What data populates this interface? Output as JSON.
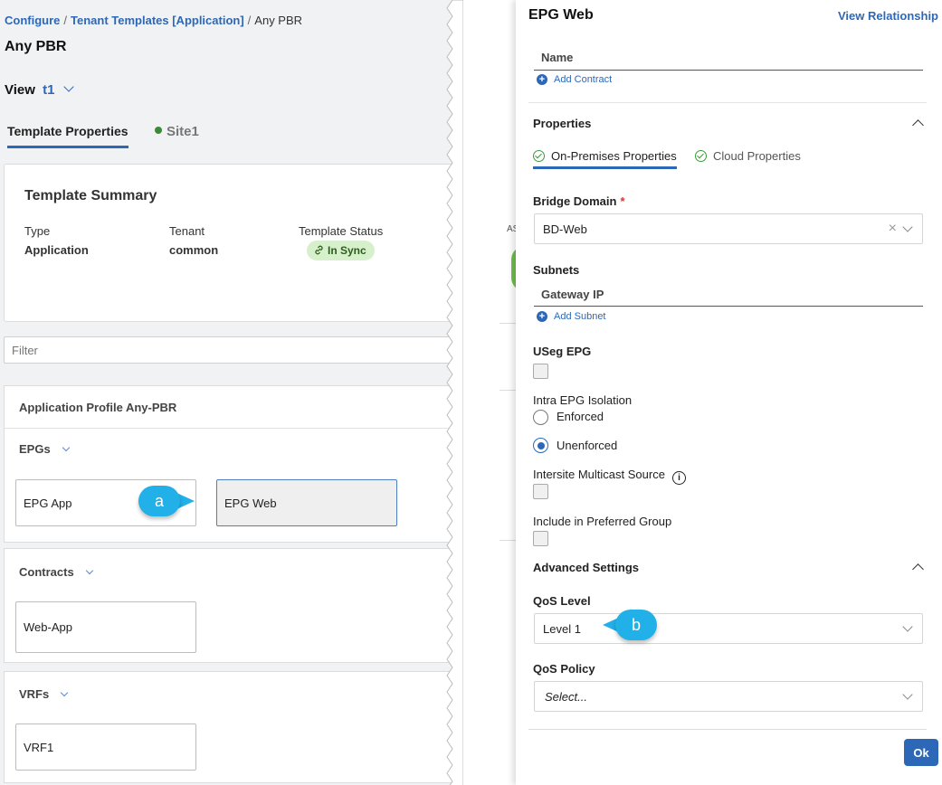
{
  "breadcrumb": {
    "item1": "Configure",
    "item2": "Tenant Templates [Application]",
    "item3": "Any PBR",
    "separator": "/"
  },
  "page_title": "Any PBR",
  "view": {
    "label": "View",
    "value": "t1"
  },
  "tabs": {
    "template_properties": "Template Properties",
    "site1": "Site1"
  },
  "summary": {
    "title": "Template Summary",
    "type_label": "Type",
    "type_value": "Application",
    "tenant_label": "Tenant",
    "tenant_value": "common",
    "status_label": "Template Status",
    "status_value": "In Sync"
  },
  "filter_placeholder": "Filter",
  "app_profile": {
    "title": "Application Profile Any-PBR"
  },
  "epgs": {
    "title": "EPGs",
    "items": [
      "EPG App",
      "EPG Web"
    ]
  },
  "contracts": {
    "title": "Contracts",
    "items": [
      "Web-App"
    ]
  },
  "vrfs": {
    "title": "VRFs",
    "items": [
      "VRF1"
    ]
  },
  "callouts": {
    "a": "a",
    "b": "b"
  },
  "mid_strip": {
    "fragment": "AS"
  },
  "epg_panel": {
    "title": "EPG Web",
    "view_relationship": "View Relationship",
    "contract_name_header": "Name",
    "add_contract": "Add Contract",
    "properties_title": "Properties",
    "tab_onprem": "On-Premises Properties",
    "tab_cloud": "Cloud Properties",
    "bridge_domain_label": "Bridge Domain",
    "required_mark": "*",
    "bridge_domain_value": "BD-Web",
    "subnets_label": "Subnets",
    "gateway_ip_header": "Gateway IP",
    "add_subnet": "Add Subnet",
    "useg_label": "USeg EPG",
    "intra_isolation_label": "Intra EPG Isolation",
    "enforced": "Enforced",
    "unenforced": "Unenforced",
    "intersite_label": "Intersite Multicast Source",
    "preferred_label": "Include in Preferred Group",
    "advanced_title": "Advanced Settings",
    "qos_level_label": "QoS Level",
    "qos_level_value": "Level 1",
    "qos_policy_label": "QoS Policy",
    "qos_policy_placeholder": "Select...",
    "ok_label": "Ok"
  },
  "colors": {
    "accent": "#2d68b8",
    "callout": "#21b0e8",
    "success_bg": "#d7f0cc",
    "site_dot": "#3a8a3a"
  }
}
